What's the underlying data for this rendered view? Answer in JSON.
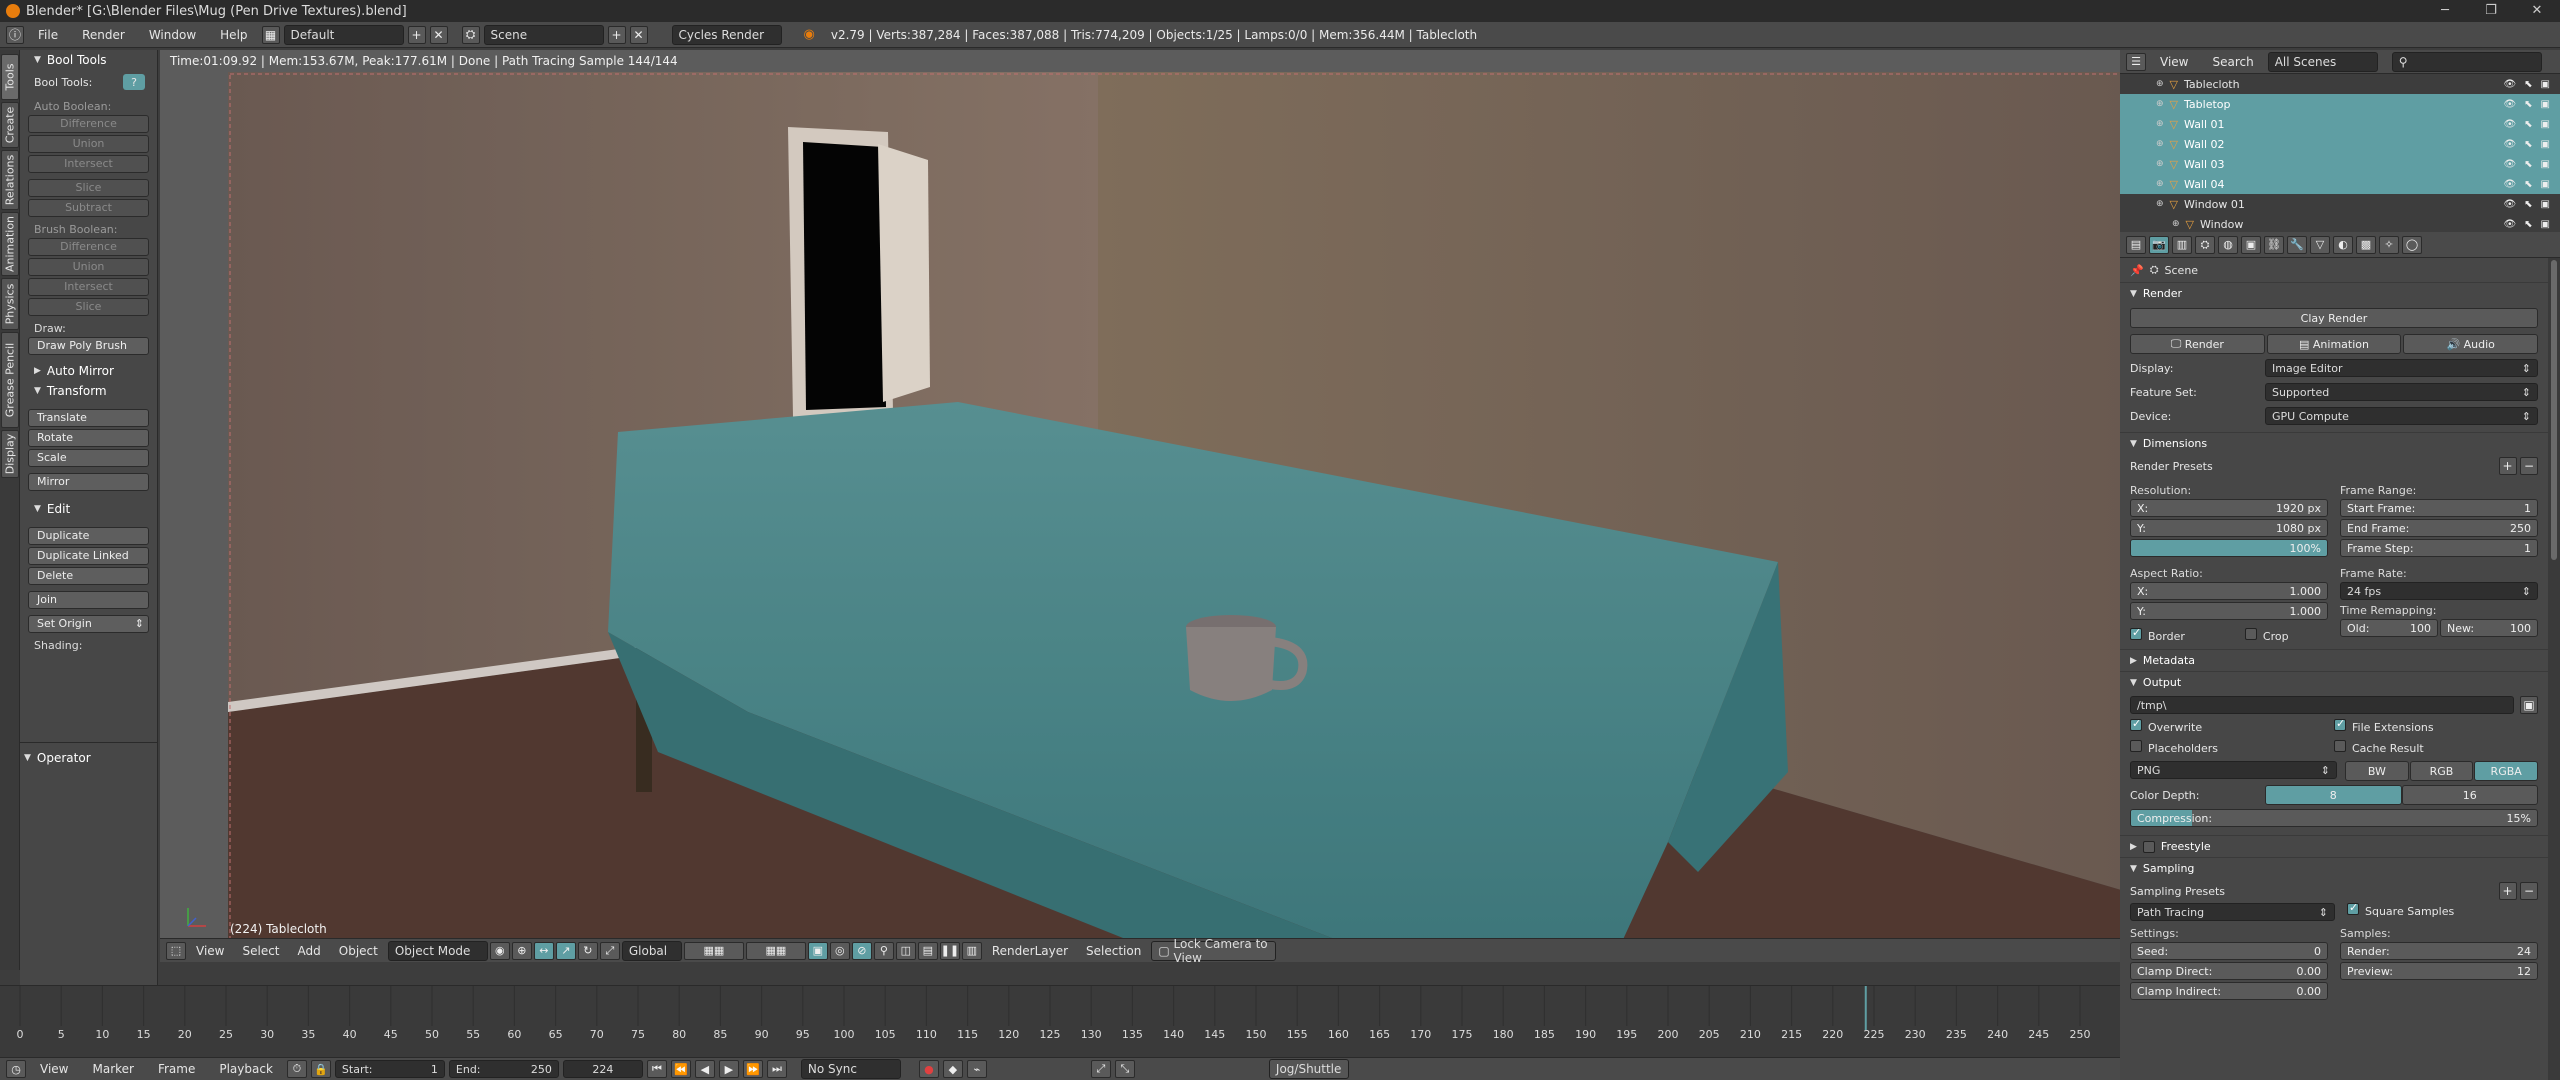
{
  "titlebar": {
    "title": "Blender* [G:\\Blender Files\\Mug (Pen Drive Textures).blend]",
    "minimize": "─",
    "maximize": "❐",
    "close": "✕"
  },
  "infobar": {
    "menus": [
      "File",
      "Render",
      "Window",
      "Help"
    ],
    "layout": "Default",
    "scene": "Scene",
    "engine": "Cycles Render",
    "stats": "v2.79 | Verts:387,284 | Faces:387,088 | Tris:774,209 | Objects:1/25 | Lamps:0/0 | Mem:356.44M | Tablecloth"
  },
  "tabs": [
    "Tools",
    "Create",
    "Relations",
    "Animation",
    "Physics",
    "Grease Pencil",
    "Display"
  ],
  "toolshelf": {
    "bool_tools_header": "Bool Tools",
    "bool_tools_label": "Bool Tools:",
    "auto_boolean_label": "Auto Boolean:",
    "auto_boolean_ops": [
      "Difference",
      "Union",
      "Intersect",
      "Slice",
      "Subtract"
    ],
    "brush_boolean_label": "Brush Boolean:",
    "brush_boolean_ops": [
      "Difference",
      "Union",
      "Intersect",
      "Slice"
    ],
    "draw_label": "Draw:",
    "draw_poly_brush": "Draw Poly Brush",
    "auto_mirror": "Auto Mirror",
    "transform_header": "Transform",
    "transform_ops": [
      "Translate",
      "Rotate",
      "Scale",
      "Mirror"
    ],
    "edit_header": "Edit",
    "edit_ops": [
      "Duplicate",
      "Duplicate Linked",
      "Delete",
      "Join"
    ],
    "set_origin": "Set Origin",
    "shading_label": "Shading:",
    "operator_header": "Operator"
  },
  "viewport": {
    "status": "Time:01:09.92 | Mem:153.67M, Peak:177.61M | Done | Path Tracing Sample 144/144",
    "object_name": "(224) Tablecloth",
    "header": {
      "menus": [
        "View",
        "Select",
        "Add",
        "Object"
      ],
      "mode": "Object Mode",
      "orientation": "Global",
      "render_layer": "RenderLayer",
      "selection": "Selection",
      "lock_camera": "Lock Camera to View"
    }
  },
  "timeline": {
    "ticks": [
      0,
      5,
      10,
      15,
      20,
      25,
      30,
      35,
      40,
      45,
      50,
      55,
      60,
      65,
      70,
      75,
      80,
      85,
      90,
      95,
      100,
      105,
      110,
      115,
      120,
      125,
      130,
      135,
      140,
      145,
      150,
      155,
      160,
      165,
      170,
      175,
      180,
      185,
      190,
      195,
      200,
      205,
      210,
      215,
      220,
      225,
      230,
      235,
      240,
      245,
      250
    ],
    "current_frame": 224,
    "header": {
      "menus": [
        "View",
        "Marker",
        "Frame",
        "Playback"
      ],
      "start_label": "Start:",
      "start_value": "1",
      "end_label": "End:",
      "end_value": "250",
      "frame_value": "224",
      "sync": "No Sync",
      "jog": "Jog/Shuttle"
    }
  },
  "outliner": {
    "menus": [
      "View",
      "Search"
    ],
    "filter": "All Scenes",
    "rows": [
      {
        "name": "Tablecloth",
        "selected": false,
        "indent": 1
      },
      {
        "name": "Tabletop",
        "selected": true,
        "indent": 1
      },
      {
        "name": "Wall 01",
        "selected": true,
        "indent": 1
      },
      {
        "name": "Wall 02",
        "selected": true,
        "indent": 1
      },
      {
        "name": "Wall 03",
        "selected": true,
        "indent": 1
      },
      {
        "name": "Wall 04",
        "selected": true,
        "indent": 1
      },
      {
        "name": "Window 01",
        "selected": false,
        "indent": 1
      },
      {
        "name": "Window",
        "selected": false,
        "indent": 2
      }
    ]
  },
  "properties": {
    "context": "Scene",
    "render_header": "Render",
    "clay_render": "Clay Render",
    "render_btn": "Render",
    "animation_btn": "Animation",
    "audio_btn": "Audio",
    "display_label": "Display:",
    "display_value": "Image Editor",
    "feature_label": "Feature Set:",
    "feature_value": "Supported",
    "device_label": "Device:",
    "device_value": "GPU Compute",
    "dimensions_header": "Dimensions",
    "render_presets": "Render Presets",
    "resolution_label": "Resolution:",
    "res_x_label": "X:",
    "res_x": "1920 px",
    "res_y_label": "Y:",
    "res_y": "1080 px",
    "res_pct": "100%",
    "frame_range_label": "Frame Range:",
    "start_frame_label": "Start Frame:",
    "start_frame": "1",
    "end_frame_label": "End Frame:",
    "end_frame": "250",
    "frame_step_label": "Frame Step:",
    "frame_step": "1",
    "aspect_label": "Aspect Ratio:",
    "aspect_x_label": "X:",
    "aspect_x": "1.000",
    "aspect_y_label": "Y:",
    "aspect_y": "1.000",
    "frame_rate_label": "Frame Rate:",
    "frame_rate": "24 fps",
    "time_remap_label": "Time Remapping:",
    "old_label": "Old:",
    "old_value": "100",
    "new_label": "New:",
    "new_value": "100",
    "border": "Border",
    "crop": "Crop",
    "metadata_header": "Metadata",
    "output_header": "Output",
    "output_path": "/tmp\\",
    "overwrite": "Overwrite",
    "file_extensions": "File Extensions",
    "placeholders": "Placeholders",
    "cache_result": "Cache Result",
    "format": "PNG",
    "bw": "BW",
    "rgb": "RGB",
    "rgba": "RGBA",
    "color_depth_label": "Color Depth:",
    "depth_8": "8",
    "depth_16": "16",
    "compression_label": "Compression:",
    "compression": "15%",
    "freestyle_header": "Freestyle",
    "sampling_header": "Sampling",
    "sampling_presets": "Sampling Presets",
    "integrator": "Path Tracing",
    "square_samples": "Square Samples",
    "settings_label": "Settings:",
    "seed_label": "Seed:",
    "seed": "0",
    "clamp_direct_label": "Clamp Direct:",
    "clamp_direct": "0.00",
    "clamp_indirect_label": "Clamp Indirect:",
    "clamp_indirect": "0.00",
    "samples_label": "Samples:",
    "render_samples_label": "Render:",
    "render_samples": "24",
    "preview_samples_label": "Preview:",
    "preview_samples": "12"
  },
  "colors": {
    "accent": "#5f9ea3",
    "tablecloth": "#4f8a8d",
    "wall": "#7d6a5e",
    "floor": "#553b33"
  }
}
